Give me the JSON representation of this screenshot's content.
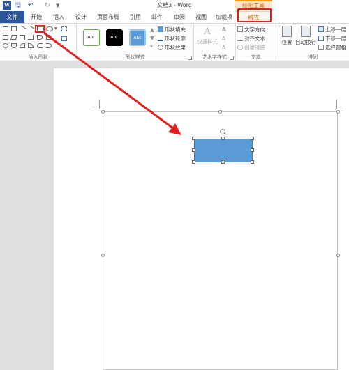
{
  "titlebar": {
    "app_icon": "W",
    "title": "文档3 - Word",
    "context_group": "绘图工具",
    "qat_icons": [
      "save-icon",
      "undo-icon",
      "redo-icon",
      "customize-icon"
    ]
  },
  "tabs": [
    "文件",
    "开始",
    "插入",
    "设计",
    "页面布局",
    "引用",
    "邮件",
    "审阅",
    "视图",
    "加载项",
    "格式"
  ],
  "ribbon": {
    "insert_shapes": {
      "label": "插入形状"
    },
    "shape_styles": {
      "label": "形状样式",
      "style_samples": [
        "Abc",
        "Abc",
        "Abc"
      ],
      "fill": "形状填充",
      "outline": "形状轮廓",
      "effects": "形状效果"
    },
    "wordart": {
      "label": "艺术字样式",
      "quick_styles": "快速样式",
      "letters": [
        "A",
        "A",
        "A"
      ]
    },
    "text": {
      "label": "文本",
      "direction": "文字方向",
      "align": "对齐文本",
      "link": "创建链接"
    },
    "arrange": {
      "label": "排列",
      "position": "位置",
      "wrap": "自动换行",
      "bring_forward": "上移一层",
      "send_backward": "下移一层",
      "selection_pane": "选择窗格"
    }
  },
  "colors": {
    "accent": "#2b579a",
    "context": "#f29c1f",
    "annotation": "#e02020",
    "shape_fill": "#5b9bd5"
  }
}
